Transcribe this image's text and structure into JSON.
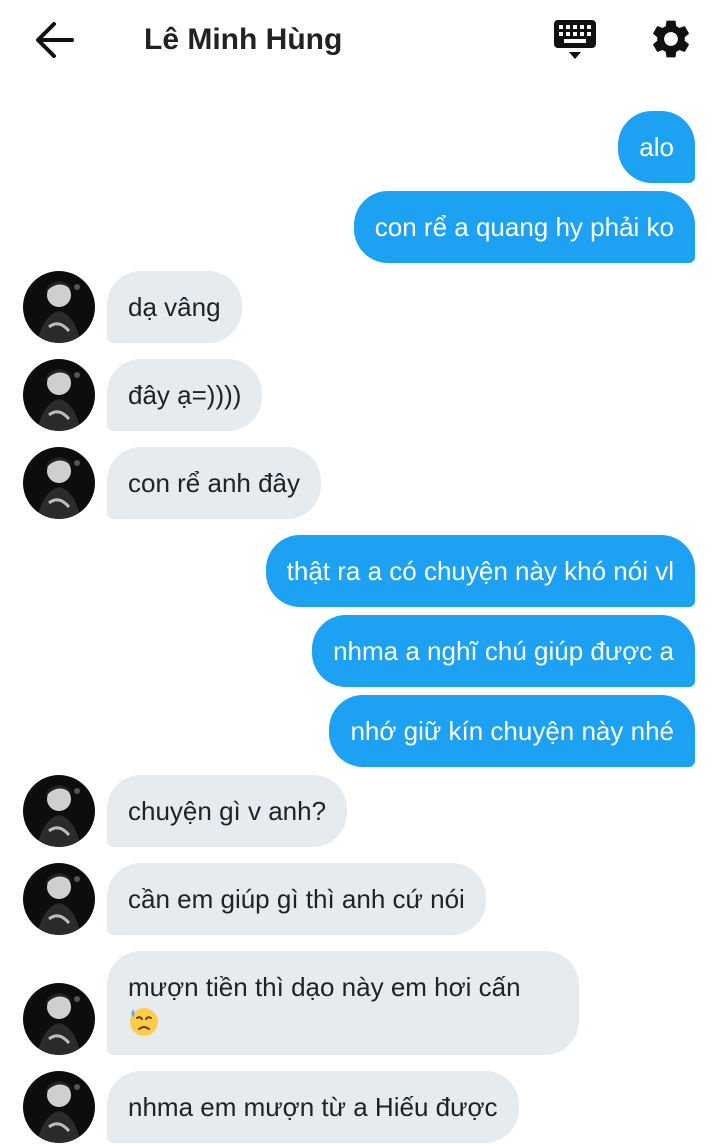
{
  "header": {
    "title": "Lê Minh Hùng",
    "back_icon": "arrow-left-icon",
    "keyboard_icon": "keyboard-icon",
    "settings_icon": "gear-icon"
  },
  "colors": {
    "outgoing_bubble": "#1da1f2",
    "incoming_bubble": "#e6ebef",
    "text_dark": "#222222"
  },
  "messages": [
    {
      "dir": "out",
      "text": "alo"
    },
    {
      "dir": "out",
      "text": "con rể a quang hy phải ko"
    },
    {
      "dir": "in",
      "text": "dạ vâng"
    },
    {
      "dir": "in",
      "text": "đây ạ=))))"
    },
    {
      "dir": "in",
      "text": "con rể anh đây"
    },
    {
      "dir": "out",
      "text": "thật ra a có chuyện này khó nói vl"
    },
    {
      "dir": "out",
      "text": "nhma a nghĩ chú giúp được a"
    },
    {
      "dir": "out",
      "text": "nhớ giữ kín chuyện này nhé"
    },
    {
      "dir": "in",
      "text": "chuyện gì v anh?"
    },
    {
      "dir": "in",
      "text": "cần em giúp gì thì anh cứ nói"
    },
    {
      "dir": "in",
      "text": "mượn tiền thì dạo này em hơi cấn",
      "emoji": "downcast-face-with-sweat"
    },
    {
      "dir": "in",
      "text": "nhma em mượn từ a Hiếu được"
    }
  ]
}
